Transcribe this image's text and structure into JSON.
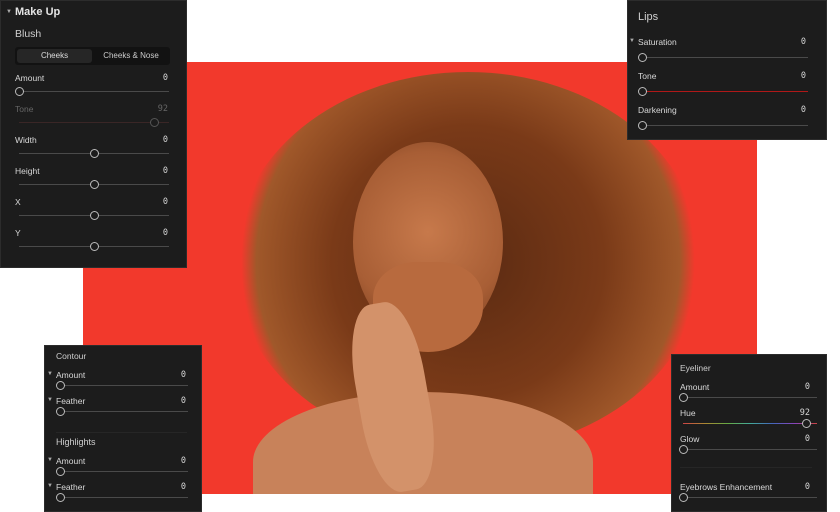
{
  "makeup": {
    "title": "Make Up",
    "section": "Blush",
    "tabs": [
      "Cheeks",
      "Cheeks & Nose"
    ],
    "active_tab": 0,
    "sliders": [
      {
        "label": "Amount",
        "value": "0",
        "position": 0
      },
      {
        "label": "Tone",
        "value": "92",
        "position": 0.9,
        "disabled": true
      },
      {
        "label": "Width",
        "value": "0",
        "position": 0.5
      },
      {
        "label": "Height",
        "value": "0",
        "position": 0.5
      },
      {
        "label": "X",
        "value": "0",
        "position": 0.5
      },
      {
        "label": "Y",
        "value": "0",
        "position": 0.5
      }
    ]
  },
  "lips": {
    "title": "Lips",
    "sliders": [
      {
        "label": "Saturation",
        "value": "0",
        "position": 0
      },
      {
        "label": "Tone",
        "value": "0",
        "position": 0
      },
      {
        "label": "Darkening",
        "value": "0",
        "position": 0
      }
    ]
  },
  "contour": {
    "title": "Contour",
    "sliders": [
      {
        "label": "Amount",
        "value": "0",
        "position": 0
      },
      {
        "label": "Feather",
        "value": "0",
        "position": 0
      }
    ],
    "highlights_title": "Highlights",
    "highlights": [
      {
        "label": "Amount",
        "value": "0",
        "position": 0
      },
      {
        "label": "Feather",
        "value": "0",
        "position": 0
      }
    ]
  },
  "eyeliner": {
    "title": "Eyeliner",
    "sliders": [
      {
        "label": "Amount",
        "value": "0",
        "position": 0
      },
      {
        "label": "Hue",
        "value": "92",
        "position": 0.92
      },
      {
        "label": "Glow",
        "value": "0",
        "position": 0
      }
    ],
    "eyebrows": {
      "label": "Eyebrows Enhancement",
      "value": "0",
      "position": 0
    }
  },
  "colors": {
    "photo_bg": "#f2392c",
    "panel": "#1c1c1c",
    "lips_tone_track": "#b01818"
  }
}
